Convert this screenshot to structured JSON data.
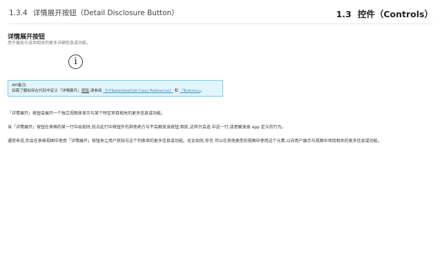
{
  "header": {
    "section_number": "1.3.4",
    "section_title": "详情展开按钮（Detail Disclosure Button）",
    "chapter_number": "1.3",
    "chapter_title": "控件（Controls）"
  },
  "item": {
    "title": "详情展开按钮",
    "subtitle": "用于展现与该项相关的更多详细信息或功能。",
    "button_glyph": "i",
    "button_icon": "info-circle-icon"
  },
  "note": {
    "label": "API备注:",
    "text_before": "如需了解如何在代码中定义「详情展开」",
    "underlined_word": "按钮",
    "text_middle": ",请参阅",
    "link1": "《UITableViewCell Class Reference》",
    "conjunction": "和",
    "link2": "「Buttons」",
    "text_end": "。",
    "accent_color": "#7fc9e4",
    "background_color": "#e2f5fb"
  },
  "paragraphs": [
    "「详情展开」按钮会展开一个独立视图来显示与某个特定项目相关的更多信息或功能。",
    "当「详情展开」按钮在表格的某一行中出现时,轻点此行中按钮外的其他地方与不会触发该按钮;相反,这样只会选 中这一行,或者触发由 app 定义的行为。",
    "通常来说,你会在表格视图中使用「详情展开」按钮来让用户获知与这个列表项的更多信息或功能。无论如何,你也 可以在其他类型的视图中使用这个元素,以向用户展示与视图中项目相关的更多信息或功能。"
  ]
}
